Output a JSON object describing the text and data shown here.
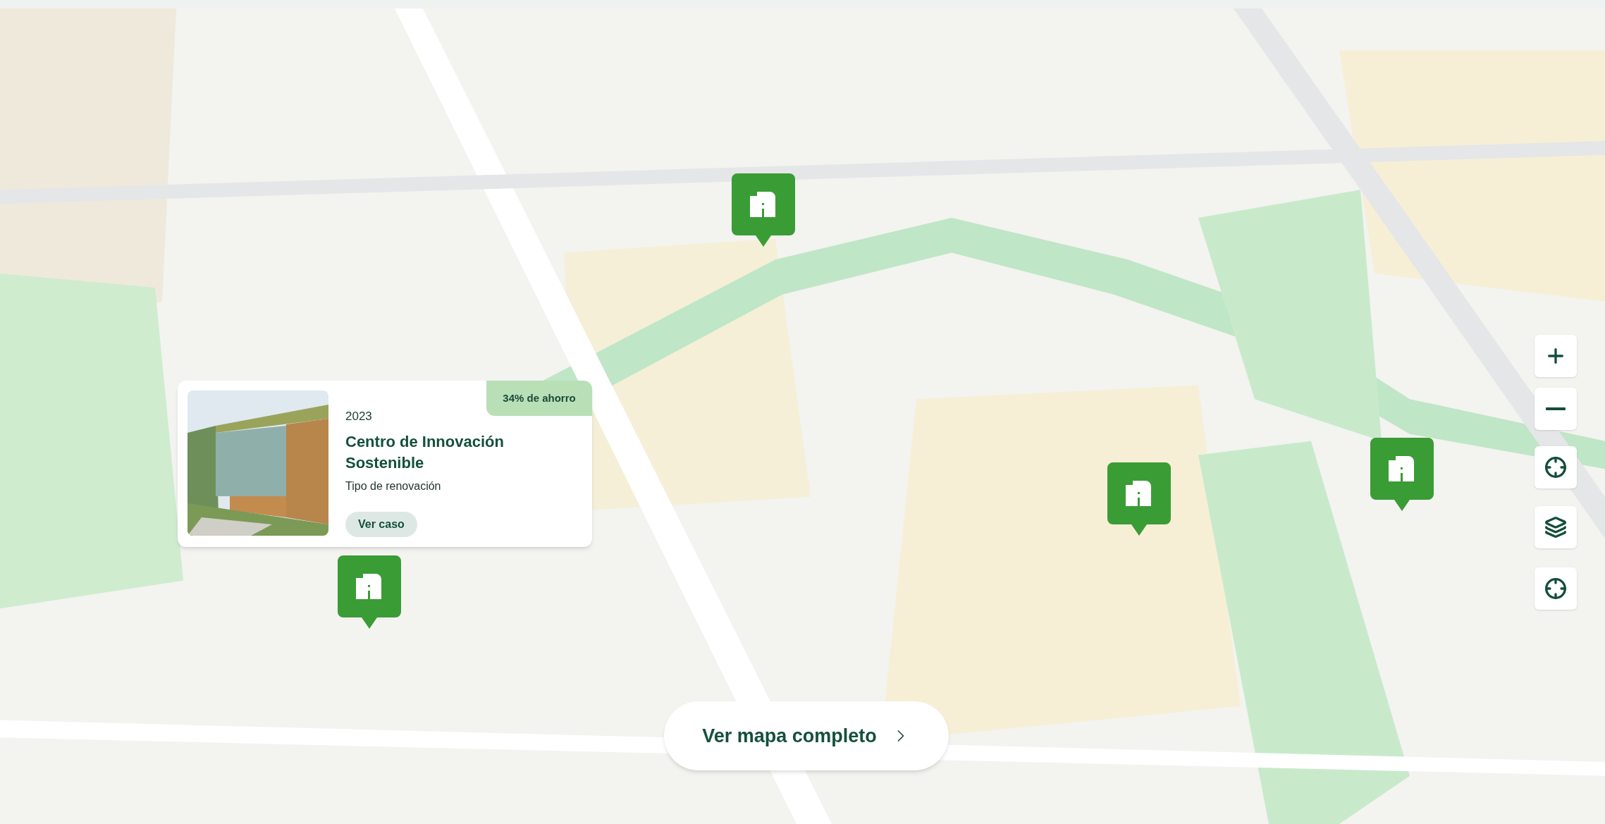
{
  "project_card": {
    "savings_badge": "34% de ahorro",
    "year": "2023",
    "title": "Centro de Innovación Sostenible",
    "subtitle": "Tipo de renovación",
    "button": "Ver caso"
  },
  "map_button": {
    "label": "Ver mapa completo"
  }
}
